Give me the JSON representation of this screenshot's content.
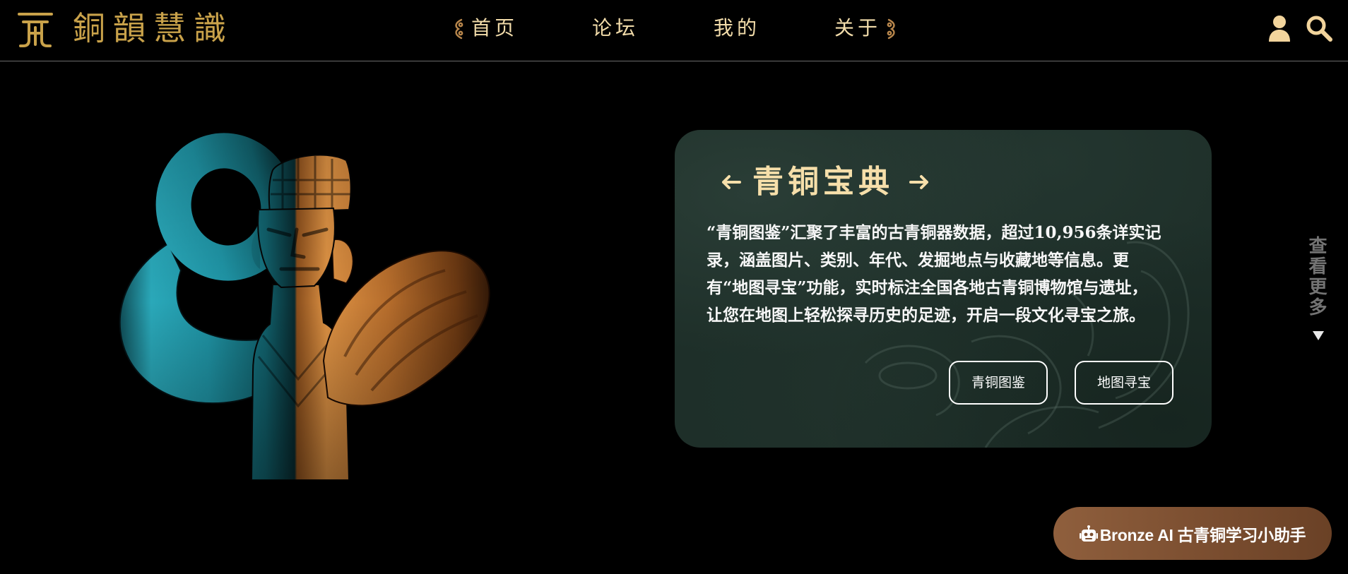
{
  "colors": {
    "background": "#000000",
    "gold": "#c9a24a",
    "cream": "#f2dcaa",
    "card": "#1e2f29",
    "assistant_bronze": "#8f5f3d",
    "muted_text": "#737373"
  },
  "header": {
    "logo_icon": "logo-mark-icon",
    "logo_text": "銅韻慧識",
    "nav": {
      "ornament_left_icon": "ornament-left-icon",
      "items": [
        {
          "label": "首页"
        },
        {
          "label": "论坛"
        },
        {
          "label": "我的"
        },
        {
          "label": "关于"
        }
      ],
      "ornament_right_icon": "ornament-right-icon"
    },
    "actions": {
      "user_icon": "user-icon",
      "search_icon": "search-icon"
    }
  },
  "hero": {
    "card": {
      "prev_icon": "arrow-left-icon",
      "title": "青铜宝典",
      "next_icon": "arrow-right-icon",
      "intro_lines": [
        "“青铜图鉴”汇聚了丰富的古青铜器数据，超过10,956条详实记",
        "录，涵盖图片、类别、年代、发掘地点与收藏地等信息。更",
        "有“地图寻宝”功能，实时标注全国各地古青铜博物馆与遗址，",
        "让您在地图上轻松探寻历史的足迹，开启一段文化寻宝之旅。"
      ],
      "buttons": [
        {
          "label": "青铜图鉴"
        },
        {
          "label": "地图寻宝"
        }
      ]
    }
  },
  "see_more": {
    "label": "查看更多",
    "icon": "triangle-down-icon"
  },
  "assistant": {
    "icon": "robot-icon",
    "label": "Bronze AI 古青铜学习小助手"
  }
}
